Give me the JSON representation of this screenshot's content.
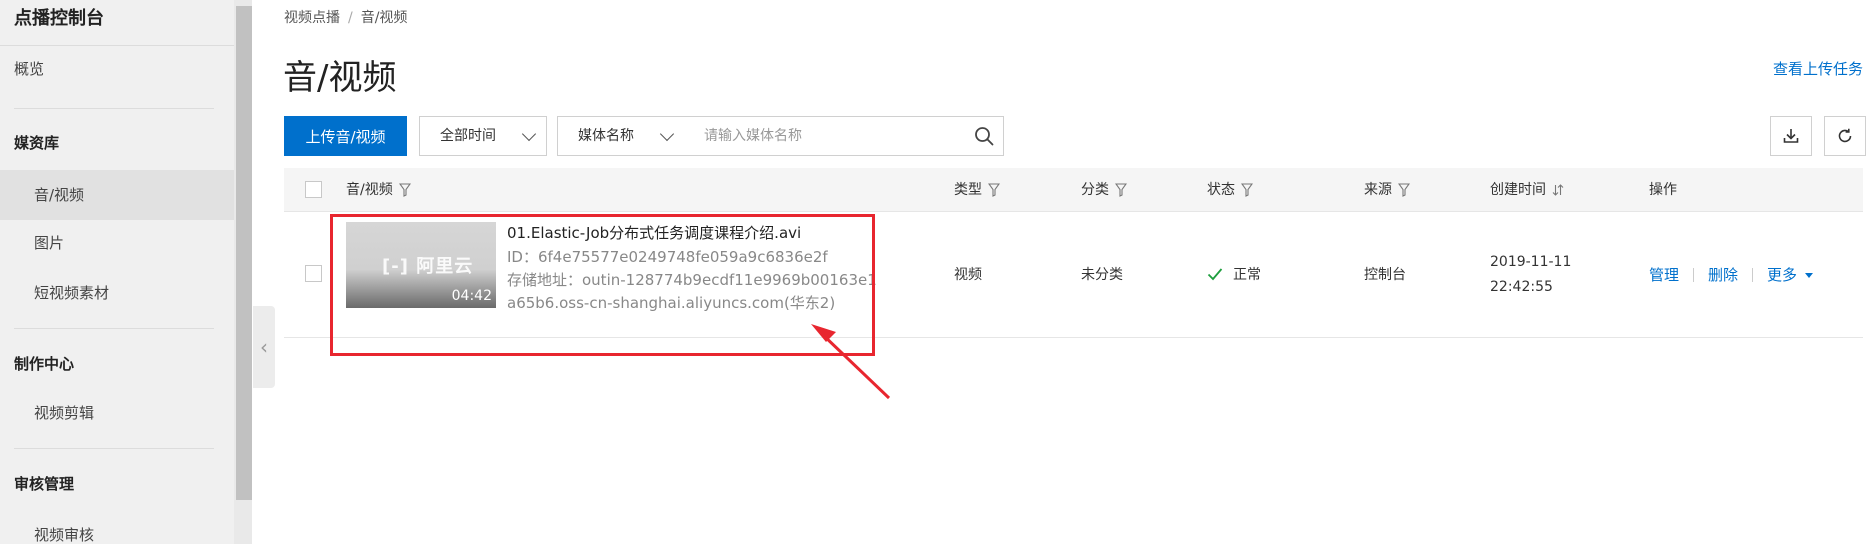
{
  "sidebar": {
    "title": "点播控制台",
    "items": [
      {
        "label": "概览"
      },
      {
        "label": "媒资库"
      },
      {
        "label": "音/视频"
      },
      {
        "label": "图片"
      },
      {
        "label": "短视频素材"
      },
      {
        "label": "制作中心"
      },
      {
        "label": "视频剪辑"
      },
      {
        "label": "审核管理"
      },
      {
        "label": "视频审核"
      }
    ]
  },
  "breadcrumb": {
    "root": "视频点播",
    "sep": "/",
    "current": "音/视频"
  },
  "page": {
    "title": "音/视频",
    "upload_tasks_link": "查看上传任务"
  },
  "toolbar": {
    "upload_label": "上传音/视频",
    "time_select": "全部时间",
    "field_select": "媒体名称",
    "search_placeholder": "请输入媒体名称"
  },
  "table": {
    "columns": {
      "media": "音/视频",
      "type": "类型",
      "category": "分类",
      "status": "状态",
      "source": "来源",
      "created": "创建时间",
      "actions": "操作"
    },
    "rows": [
      {
        "title": "01.Elastic-Job分布式任务调度课程介绍.avi",
        "id_line": "ID：6f4e75577e0249748fe059a9c6836e2f",
        "storage_line": "存储地址：outin-128774b9ecdf11e9969b00163e1a65b6.oss-cn-shanghai.aliyuncs.com(华东2)",
        "duration": "04:42",
        "thumb_logo": "[-] 阿里云",
        "type": "视频",
        "category": "未分类",
        "status": "正常",
        "source": "控制台",
        "created_date": "2019-11-11",
        "created_time": "22:42:55",
        "actions": {
          "manage": "管理",
          "delete": "删除",
          "more": "更多"
        }
      }
    ]
  },
  "colors": {
    "accent": "#0070cc",
    "highlight": "#e8262f",
    "success": "#1e9e3e"
  }
}
